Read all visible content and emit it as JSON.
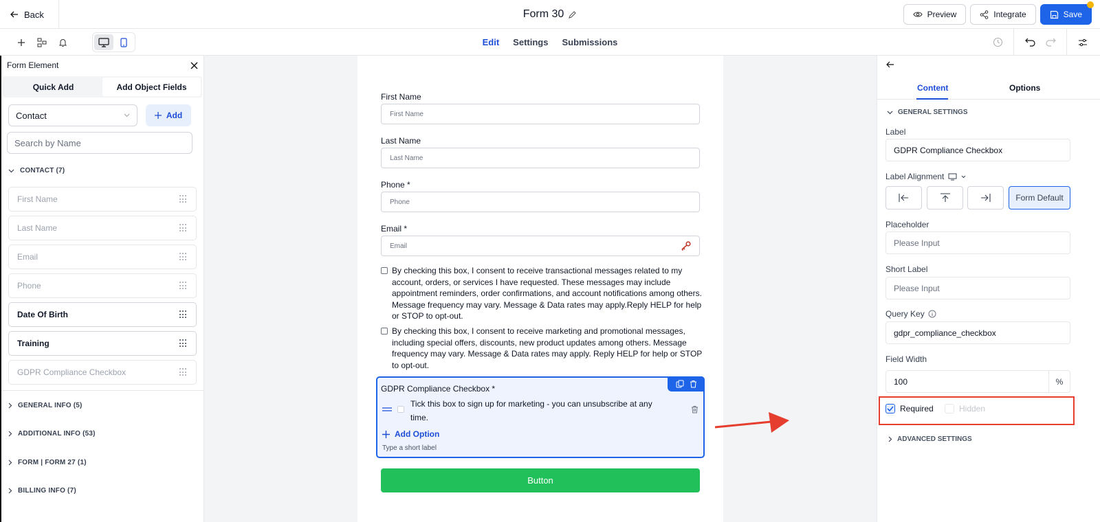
{
  "header": {
    "back_label": "Back",
    "form_title": "Form 30",
    "preview_label": "Preview",
    "integrate_label": "Integrate",
    "save_label": "Save"
  },
  "toolbar": {
    "tabs": [
      "Edit",
      "Settings",
      "Submissions"
    ],
    "active_tab": "Edit"
  },
  "left_panel": {
    "title": "Form Element",
    "tabs": [
      "Quick Add",
      "Add Object Fields"
    ],
    "object_select": "Contact",
    "add_label": "Add",
    "search_placeholder": "Search by Name",
    "contact_section": "CONTACT (7)",
    "contact_fields": [
      "First Name",
      "Last Name",
      "Email",
      "Phone",
      "Date Of Birth",
      "Training",
      "GDPR Compliance Checkbox"
    ],
    "sections": [
      "GENERAL INFO (5)",
      "ADDITIONAL INFO (53)",
      "FORM | FORM 27 (1)",
      "BILLING INFO (7)"
    ]
  },
  "form": {
    "first_name_label": "First Name",
    "first_name_placeholder": "First Name",
    "last_name_label": "Last Name",
    "last_name_placeholder": "Last Name",
    "phone_label": "Phone *",
    "phone_placeholder": "Phone",
    "email_label": "Email *",
    "email_placeholder": "Email",
    "consent_transactional": "By checking this box, I consent to receive transactional messages related to my account, orders, or services I have requested. These messages may include appointment reminders, order confirmations, and account notifications among others. Message frequency may vary. Message & Data rates may apply.Reply HELP for help or STOP to opt-out.",
    "consent_marketing": "By checking this box, I consent to receive marketing and promotional messages, including special offers, discounts, new product updates among others. Message frequency may vary. Message & Data rates may apply. Reply HELP for help or STOP to opt-out.",
    "gdpr_label": "GDPR Compliance Checkbox *",
    "gdpr_option": "Tick this box to sign up for marketing - you can unsubscribe at any time.",
    "add_option_label": "Add Option",
    "short_label_hint": "Type a short label",
    "submit_label": "Button"
  },
  "right_panel": {
    "tabs": [
      "Content",
      "Options"
    ],
    "general_settings": "GENERAL SETTINGS",
    "label_title": "Label",
    "label_value": "GDPR Compliance Checkbox",
    "label_alignment_title": "Label Alignment",
    "form_default_label": "Form Default",
    "placeholder_title": "Placeholder",
    "placeholder_value": "Please Input",
    "short_label_title": "Short Label",
    "short_label_value": "Please Input",
    "query_key_title": "Query Key",
    "query_key_value": "gdpr_compliance_checkbox",
    "field_width_title": "Field Width",
    "field_width_value": "100",
    "field_width_unit": "%",
    "required_label": "Required",
    "required_checked": true,
    "hidden_label": "Hidden",
    "hidden_checked": false,
    "advanced_settings": "ADVANCED SETTINGS"
  },
  "colors": {
    "primary": "#1d64e8",
    "submit_green": "#22c05a",
    "annotation_red": "#e53e2f"
  }
}
